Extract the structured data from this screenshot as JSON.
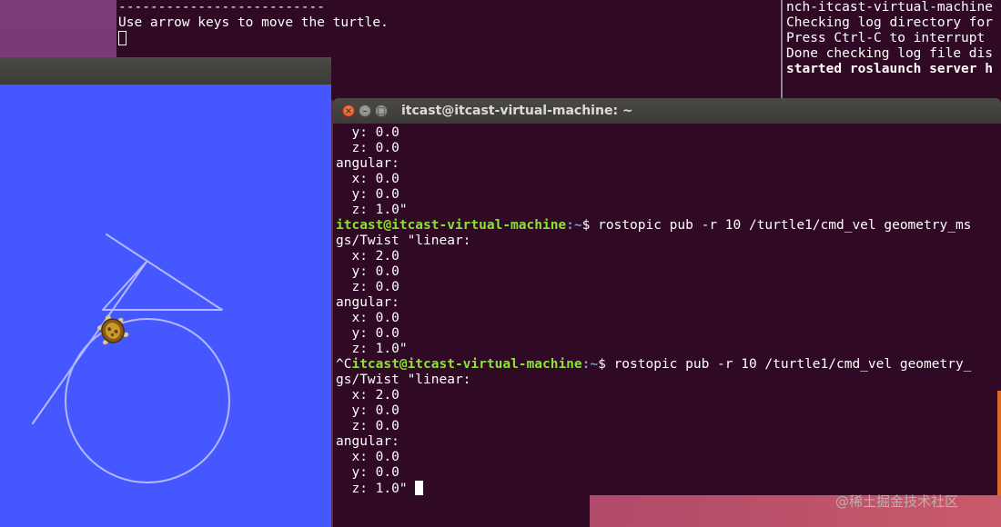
{
  "teleop_terminal": {
    "lines": [
      "--------------------------",
      "Use arrow keys to move the turtle."
    ]
  },
  "roslaunch_terminal": {
    "lines": [
      "nch-itcast-virtual-machine",
      "Checking log directory for",
      "Press Ctrl-C to interrupt",
      "Done checking log file dis",
      "",
      "started roslaunch server h"
    ]
  },
  "main_terminal": {
    "title": "itcast@itcast-virtual-machine: ~",
    "block1": [
      "  y: 0.0",
      "  z: 0.0",
      "angular:",
      "  x: 0.0",
      "  y: 0.0",
      "  z: 1.0\""
    ],
    "command1": {
      "user": "itcast@itcast-virtual-machine",
      "path": ":~",
      "text": "$ rostopic pub -r 10 /turtle1/cmd_vel geometry_ms",
      "wrap": "gs/Twist \"linear:"
    },
    "block2": [
      "  x: 2.0",
      "  y: 0.0",
      "  z: 0.0",
      "angular:",
      "  x: 0.0",
      "  y: 0.0",
      "  z: 1.0\""
    ],
    "command2": {
      "prefix": "^C",
      "user": "itcast@itcast-virtual-machine",
      "path": ":~",
      "text": "$ rostopic pub -r 10 /turtle1/cmd_vel geometry_",
      "wrap": "gs/Twist \"linear:"
    },
    "block3": [
      "  x: 2.0",
      "  y: 0.0",
      "  z: 0.0",
      "angular:",
      "  x: 0.0",
      "  y: 0.0",
      "  z: 1.0\" "
    ]
  },
  "watermark": "@稀土掘金技术社区",
  "colors": {
    "terminal_bg": "#300a24",
    "turtlesim_bg": "#4557ff",
    "prompt_user": "#8ae234",
    "prompt_path": "#729fcf"
  }
}
